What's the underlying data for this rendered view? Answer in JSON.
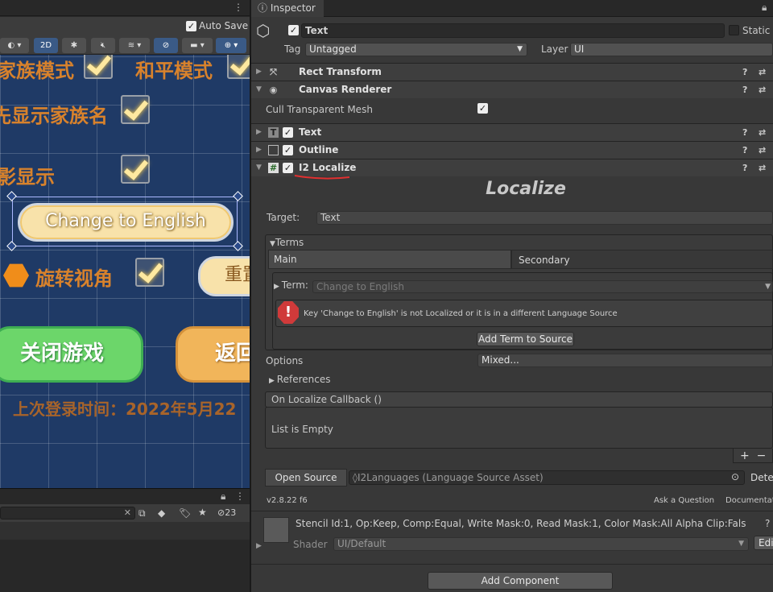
{
  "scene_view": {
    "auto_save_label": "Auto Save",
    "toolbar": {
      "mode_2d": "2D",
      "gizmo_count": "23"
    },
    "labels": {
      "family_mode": "家族模式",
      "peace_mode": "和平模式",
      "show_family_name": "先显示家族名",
      "shadow_show": "影显示",
      "rotate_view": "旋转视角",
      "reset": "重置"
    },
    "buttons": {
      "change_english": "Change to English",
      "close_game": "关闭游戏",
      "back": "返回"
    },
    "last_login": "上次登录时间：2022年5月22"
  },
  "inspector": {
    "tab_title": "Inspector",
    "object_name": "Text",
    "static_label": "Static",
    "tag_label": "Tag",
    "tag_value": "Untagged",
    "layer_label": "Layer",
    "layer_value": "UI",
    "components": {
      "rect_transform": "Rect Transform",
      "canvas_renderer": "Canvas Renderer",
      "cull_label": "Cull Transparent Mesh",
      "text": "Text",
      "outline": "Outline",
      "i2_localize": "I2 Localize"
    },
    "localize": {
      "heading": "Localize",
      "target_label": "Target:",
      "target_value": "Text",
      "terms_label": "Terms",
      "main_tab": "Main",
      "secondary_tab": "Secondary",
      "term_label": "Term:",
      "term_value": "Change to English",
      "warning": "Key 'Change to English' is not Localized or it is in a different Language Source",
      "add_term_button": "Add Term to Source",
      "options_label": "Options",
      "options_value": "Mixed...",
      "references_label": "References",
      "callback_label": "On Localize Callback ()",
      "list_empty": "List is Empty",
      "open_source_button": "Open Source",
      "source_value": "I2Languages (Language Source Asset)",
      "detect_label": "Dete",
      "version": "v2.8.22 f6",
      "ask_question": "Ask a Question",
      "documentation": "Documentat"
    },
    "material": {
      "stencil": "Stencil Id:1, Op:Keep, Comp:Equal, Write Mask:0, Read Mask:1, Color Mask:All Alpha Clip:Fals",
      "shader_label": "Shader",
      "shader_value": "UI/Default",
      "edit_label": "Edit"
    },
    "add_component_button": "Add Component"
  }
}
